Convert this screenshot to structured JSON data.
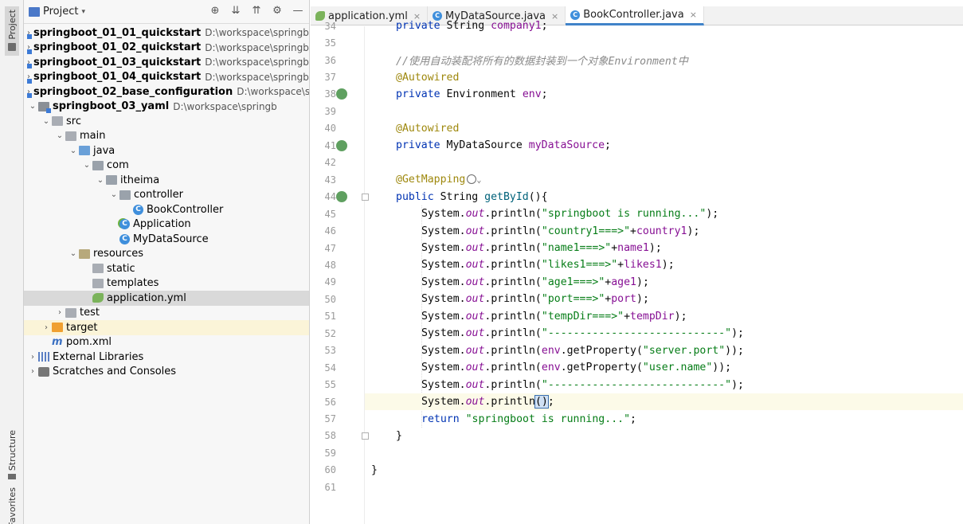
{
  "toolstrip": {
    "project_label": "Project",
    "structure_label": "Structure",
    "favorites_label": "Favorites"
  },
  "panel": {
    "title": "Project",
    "tools": [
      "target-icon",
      "expand-all-icon",
      "collapse-all-icon",
      "gear-icon",
      "minimize-icon"
    ]
  },
  "tree": [
    {
      "depth": 0,
      "arrow": "›",
      "icon": "module",
      "name": "springboot_01_01_quickstart",
      "bold": true,
      "path": "D:\\workspace\\springboo"
    },
    {
      "depth": 0,
      "arrow": "›",
      "icon": "module",
      "name": "springboot_01_02_quickstart",
      "bold": true,
      "path": "D:\\workspace\\springboo"
    },
    {
      "depth": 0,
      "arrow": "›",
      "icon": "module",
      "name": "springboot_01_03_quickstart",
      "bold": true,
      "path": "D:\\workspace\\springboo"
    },
    {
      "depth": 0,
      "arrow": "›",
      "icon": "module",
      "name": "springboot_01_04_quickstart",
      "bold": true,
      "path": "D:\\workspace\\springboo"
    },
    {
      "depth": 0,
      "arrow": "›",
      "icon": "module",
      "name": "springboot_02_base_configuration",
      "bold": true,
      "path": "D:\\workspace\\sprir"
    },
    {
      "depth": 0,
      "arrow": "⌄",
      "icon": "module",
      "name": "springboot_03_yaml",
      "bold": true,
      "path": "D:\\workspace\\springb"
    },
    {
      "depth": 1,
      "arrow": "⌄",
      "icon": "folder",
      "name": "src",
      "bold": false,
      "path": ""
    },
    {
      "depth": 2,
      "arrow": "⌄",
      "icon": "folder",
      "name": "main",
      "bold": false,
      "path": ""
    },
    {
      "depth": 3,
      "arrow": "⌄",
      "icon": "folder-src",
      "name": "java",
      "bold": false,
      "path": ""
    },
    {
      "depth": 4,
      "arrow": "⌄",
      "icon": "package",
      "name": "com",
      "bold": false,
      "path": ""
    },
    {
      "depth": 5,
      "arrow": "⌄",
      "icon": "package",
      "name": "itheima",
      "bold": false,
      "path": ""
    },
    {
      "depth": 6,
      "arrow": "⌄",
      "icon": "package",
      "name": "controller",
      "bold": false,
      "path": ""
    },
    {
      "depth": 7,
      "arrow": "",
      "icon": "class",
      "name": "BookController",
      "bold": false,
      "path": ""
    },
    {
      "depth": 6,
      "arrow": "",
      "icon": "spring",
      "name": "Application",
      "bold": false,
      "path": ""
    },
    {
      "depth": 6,
      "arrow": "",
      "icon": "class",
      "name": "MyDataSource",
      "bold": false,
      "path": ""
    },
    {
      "depth": 3,
      "arrow": "⌄",
      "icon": "folder-res",
      "name": "resources",
      "bold": false,
      "path": ""
    },
    {
      "depth": 4,
      "arrow": "",
      "icon": "folder",
      "name": "static",
      "bold": false,
      "path": ""
    },
    {
      "depth": 4,
      "arrow": "",
      "icon": "folder",
      "name": "templates",
      "bold": false,
      "path": ""
    },
    {
      "depth": 4,
      "arrow": "",
      "icon": "yml",
      "name": "application.yml",
      "bold": false,
      "path": "",
      "state": "selected"
    },
    {
      "depth": 2,
      "arrow": "›",
      "icon": "folder",
      "name": "test",
      "bold": false,
      "path": ""
    },
    {
      "depth": 1,
      "arrow": "›",
      "icon": "folder-target",
      "name": "target",
      "bold": false,
      "path": "",
      "state": "highlight"
    },
    {
      "depth": 1,
      "arrow": "",
      "icon": "maven",
      "name": "pom.xml",
      "bold": false,
      "path": ""
    },
    {
      "depth": 0,
      "arrow": "›",
      "icon": "libs",
      "name": "External Libraries",
      "bold": false,
      "path": ""
    },
    {
      "depth": 0,
      "arrow": "›",
      "icon": "scratch",
      "name": "Scratches and Consoles",
      "bold": false,
      "path": ""
    }
  ],
  "tabs": [
    {
      "label": "application.yml",
      "icon": "yml",
      "active": false
    },
    {
      "label": "MyDataSource.java",
      "icon": "class",
      "active": false
    },
    {
      "label": "BookController.java",
      "icon": "class",
      "active": true
    }
  ],
  "code": [
    {
      "n": "34",
      "indent": 1,
      "tokens": [
        [
          "k-kw",
          "private "
        ],
        [
          "k-ident",
          "String "
        ],
        [
          "k-field",
          "company1"
        ],
        [
          "k-plain",
          ";"
        ]
      ],
      "partial": true
    },
    {
      "n": "35",
      "indent": 0,
      "tokens": []
    },
    {
      "n": "36",
      "indent": 1,
      "tokens": [
        [
          "k-comment",
          "//使用自动装配将所有的数据封装到一个对象Environment中"
        ]
      ]
    },
    {
      "n": "37",
      "indent": 1,
      "tokens": [
        [
          "k-ann",
          "@Autowired"
        ]
      ]
    },
    {
      "n": "38",
      "indent": 1,
      "mark": true,
      "tokens": [
        [
          "k-kw",
          "private "
        ],
        [
          "k-ident",
          "Environment "
        ],
        [
          "k-field",
          "env"
        ],
        [
          "k-plain",
          ";"
        ]
      ]
    },
    {
      "n": "39",
      "indent": 0,
      "tokens": []
    },
    {
      "n": "40",
      "indent": 1,
      "tokens": [
        [
          "k-ann",
          "@Autowired"
        ]
      ]
    },
    {
      "n": "41",
      "indent": 1,
      "mark": true,
      "tokens": [
        [
          "k-kw",
          "private "
        ],
        [
          "k-ident",
          "MyDataSource "
        ],
        [
          "k-field",
          "myDataSource"
        ],
        [
          "k-plain",
          ";"
        ]
      ]
    },
    {
      "n": "42",
      "indent": 0,
      "tokens": []
    },
    {
      "n": "43",
      "indent": 1,
      "inlay": true,
      "tokens": [
        [
          "k-ann",
          "@GetMapping"
        ]
      ]
    },
    {
      "n": "44",
      "indent": 1,
      "mark": true,
      "fold": true,
      "tokens": [
        [
          "k-kw",
          "public "
        ],
        [
          "k-ident",
          "String "
        ],
        [
          "k-fn",
          "getById"
        ],
        [
          "k-plain",
          "(){"
        ]
      ]
    },
    {
      "n": "45",
      "indent": 2,
      "tokens": [
        [
          "k-ident",
          "System."
        ],
        [
          "k-static",
          "out"
        ],
        [
          "k-plain",
          ".println("
        ],
        [
          "k-str",
          "\"springboot is running...\""
        ],
        [
          "k-plain",
          ");"
        ]
      ]
    },
    {
      "n": "46",
      "indent": 2,
      "tokens": [
        [
          "k-ident",
          "System."
        ],
        [
          "k-static",
          "out"
        ],
        [
          "k-plain",
          ".println("
        ],
        [
          "k-str",
          "\"country1===>\""
        ],
        [
          "k-plain",
          "+"
        ],
        [
          "k-field",
          "country1"
        ],
        [
          "k-plain",
          ");"
        ]
      ]
    },
    {
      "n": "47",
      "indent": 2,
      "tokens": [
        [
          "k-ident",
          "System."
        ],
        [
          "k-static",
          "out"
        ],
        [
          "k-plain",
          ".println("
        ],
        [
          "k-str",
          "\"name1===>\""
        ],
        [
          "k-plain",
          "+"
        ],
        [
          "k-field",
          "name1"
        ],
        [
          "k-plain",
          ");"
        ]
      ]
    },
    {
      "n": "48",
      "indent": 2,
      "tokens": [
        [
          "k-ident",
          "System."
        ],
        [
          "k-static",
          "out"
        ],
        [
          "k-plain",
          ".println("
        ],
        [
          "k-str",
          "\"likes1===>\""
        ],
        [
          "k-plain",
          "+"
        ],
        [
          "k-field",
          "likes1"
        ],
        [
          "k-plain",
          ");"
        ]
      ]
    },
    {
      "n": "49",
      "indent": 2,
      "tokens": [
        [
          "k-ident",
          "System."
        ],
        [
          "k-static",
          "out"
        ],
        [
          "k-plain",
          ".println("
        ],
        [
          "k-str",
          "\"age1===>\""
        ],
        [
          "k-plain",
          "+"
        ],
        [
          "k-field",
          "age1"
        ],
        [
          "k-plain",
          ");"
        ]
      ]
    },
    {
      "n": "50",
      "indent": 2,
      "tokens": [
        [
          "k-ident",
          "System."
        ],
        [
          "k-static",
          "out"
        ],
        [
          "k-plain",
          ".println("
        ],
        [
          "k-str",
          "\"port===>\""
        ],
        [
          "k-plain",
          "+"
        ],
        [
          "k-field",
          "port"
        ],
        [
          "k-plain",
          ");"
        ]
      ]
    },
    {
      "n": "51",
      "indent": 2,
      "tokens": [
        [
          "k-ident",
          "System."
        ],
        [
          "k-static",
          "out"
        ],
        [
          "k-plain",
          ".println("
        ],
        [
          "k-str",
          "\"tempDir===>\""
        ],
        [
          "k-plain",
          "+"
        ],
        [
          "k-field",
          "tempDir"
        ],
        [
          "k-plain",
          ");"
        ]
      ]
    },
    {
      "n": "52",
      "indent": 2,
      "tokens": [
        [
          "k-ident",
          "System."
        ],
        [
          "k-static",
          "out"
        ],
        [
          "k-plain",
          ".println("
        ],
        [
          "k-str",
          "\"----------------------------\""
        ],
        [
          "k-plain",
          ");"
        ]
      ]
    },
    {
      "n": "53",
      "indent": 2,
      "tokens": [
        [
          "k-ident",
          "System."
        ],
        [
          "k-static",
          "out"
        ],
        [
          "k-plain",
          ".println("
        ],
        [
          "k-field",
          "env"
        ],
        [
          "k-plain",
          ".getProperty("
        ],
        [
          "k-str",
          "\"server.port\""
        ],
        [
          "k-plain",
          "));"
        ]
      ]
    },
    {
      "n": "54",
      "indent": 2,
      "tokens": [
        [
          "k-ident",
          "System."
        ],
        [
          "k-static",
          "out"
        ],
        [
          "k-plain",
          ".println("
        ],
        [
          "k-field",
          "env"
        ],
        [
          "k-plain",
          ".getProperty("
        ],
        [
          "k-str",
          "\"user.name\""
        ],
        [
          "k-plain",
          "));"
        ]
      ]
    },
    {
      "n": "55",
      "indent": 2,
      "tokens": [
        [
          "k-ident",
          "System."
        ],
        [
          "k-static",
          "out"
        ],
        [
          "k-plain",
          ".println("
        ],
        [
          "k-str",
          "\"----------------------------\""
        ],
        [
          "k-plain",
          ");"
        ]
      ]
    },
    {
      "n": "56",
      "indent": 2,
      "current": true,
      "tokens": [
        [
          "k-ident",
          "System."
        ],
        [
          "k-static",
          "out"
        ],
        [
          "k-plain",
          ".println"
        ],
        [
          "caret-paren",
          "()"
        ],
        [
          "k-plain",
          ";"
        ]
      ]
    },
    {
      "n": "57",
      "indent": 2,
      "tokens": [
        [
          "k-kw",
          "return "
        ],
        [
          "k-str",
          "\"springboot is running...\""
        ],
        [
          "k-plain",
          ";"
        ]
      ]
    },
    {
      "n": "58",
      "indent": 1,
      "fold": true,
      "tokens": [
        [
          "k-plain",
          "}"
        ]
      ]
    },
    {
      "n": "59",
      "indent": 0,
      "tokens": []
    },
    {
      "n": "60",
      "indent": 0,
      "tokens": [
        [
          "k-plain",
          "}"
        ]
      ]
    },
    {
      "n": "61",
      "indent": 0,
      "tokens": []
    }
  ]
}
